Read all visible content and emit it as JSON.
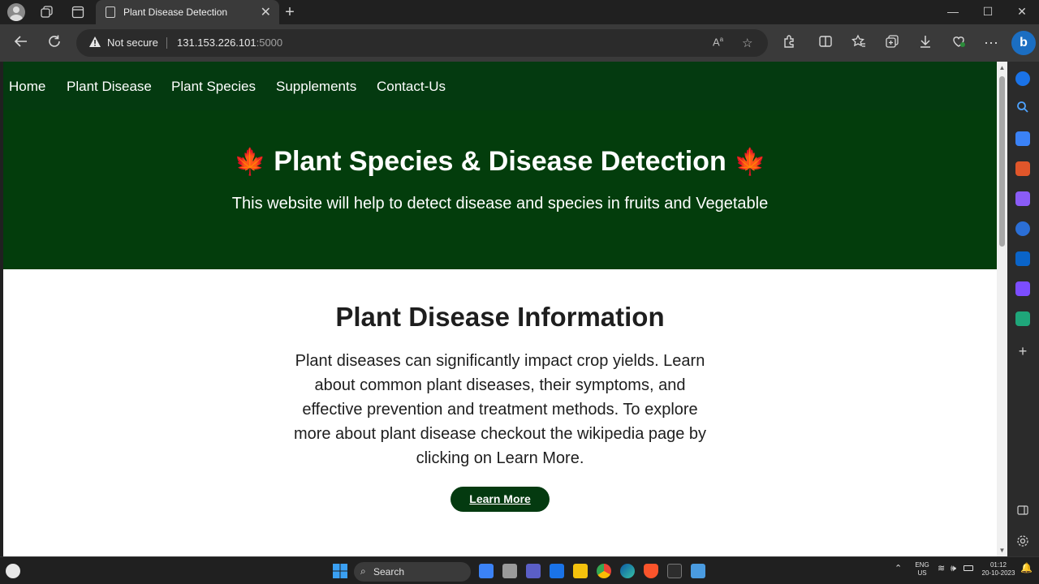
{
  "browser": {
    "tab_title": "Plant Disease Detection",
    "tab_close": "✕",
    "new_tab": "+",
    "security_label": "Not secure",
    "url_host": "131.153.226.101",
    "url_port": ":5000",
    "window_minimize": "—",
    "window_maximize": "☐",
    "window_close": "✕",
    "bing_label": "b"
  },
  "page": {
    "nav": [
      "Home",
      "Plant Disease",
      "Plant Species",
      "Supplements",
      "Contact-Us"
    ],
    "hero_title": "Plant Species & Disease Detection",
    "hero_leaf": "🍁",
    "hero_subtitle": "This website will help to detect disease and species in fruits and Vegetable",
    "section_title": "Plant Disease Information",
    "section_text": "Plant diseases can significantly impact crop yields. Learn about common plant diseases, their symptoms, and effective prevention and treatment methods. To explore more about plant disease checkout the wikipedia page by clicking on Learn More.",
    "learn_more": "Learn More"
  },
  "taskbar": {
    "search_label": "Search",
    "lang_top": "ENG",
    "lang_bottom": "US",
    "time": "01:12",
    "date": "20-10-2023"
  },
  "colors": {
    "nav_bg": "#043a10",
    "hero_bg": "#033d0c",
    "button_bg": "#043a10"
  }
}
